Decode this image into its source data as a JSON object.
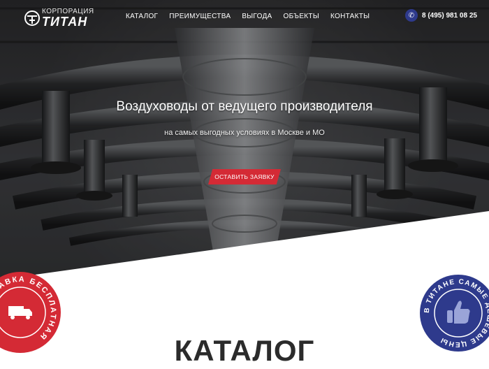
{
  "brand": {
    "small": "КОРПОРАЦИЯ",
    "main": "ТИТАН"
  },
  "nav": [
    "КАТАЛОГ",
    "ПРЕИМУЩЕСТВА",
    "ВЫГОДА",
    "ОБЪЕКТЫ",
    "КОНТАКТЫ"
  ],
  "phone": "8 (495) 981 08 25",
  "hero": {
    "title": "Воздуховоды от ведущего производителя",
    "subtitle": "на самых выгодных условиях в Москве и МО",
    "cta": "ОСТАВИТЬ ЗАЯВКУ"
  },
  "badges": {
    "left_text": "ДОСТАВКА БЕСПЛАТНАЯ",
    "right_text": "В ТИТАНЕ САМЫЕ ДЕШЕВЫЕ ЦЕНЫ"
  },
  "section_title": "КАТАЛОГ",
  "colors": {
    "accent_red": "#d42a35",
    "accent_blue": "#2e3a8c"
  }
}
